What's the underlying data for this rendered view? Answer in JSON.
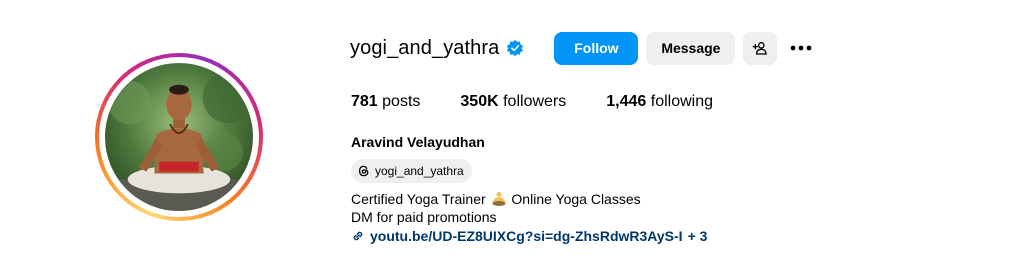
{
  "profile": {
    "username": "yogi_and_yathra",
    "full_name": "Aravind Velayudhan",
    "threads_handle": "yogi_and_yathra",
    "bio": {
      "line1_part1": "Certified Yoga Trainer",
      "line1_part2": "Online Yoga Classes",
      "line2": "DM for paid promotions"
    },
    "link": {
      "text": "youtu.be/UD-EZ8UIXCg?si=dg-ZhsRdwR3AyS-I",
      "extra": "+ 3"
    }
  },
  "actions": {
    "follow_label": "Follow",
    "message_label": "Message"
  },
  "stats": {
    "posts_count": "781",
    "posts_label": "posts",
    "followers_count": "350K",
    "followers_label": "followers",
    "following_count": "1,446",
    "following_label": "following"
  },
  "icons": {
    "verified": "verified-badge-icon",
    "add_user": "add-user-icon",
    "more": "more-options-icon",
    "threads": "threads-icon",
    "meditation": "meditation-emoji-icon",
    "link": "link-icon"
  },
  "colors": {
    "follow_button": "#0095f6",
    "secondary_button": "#efefef",
    "verified": "#0095f6",
    "link": "#00376b"
  }
}
